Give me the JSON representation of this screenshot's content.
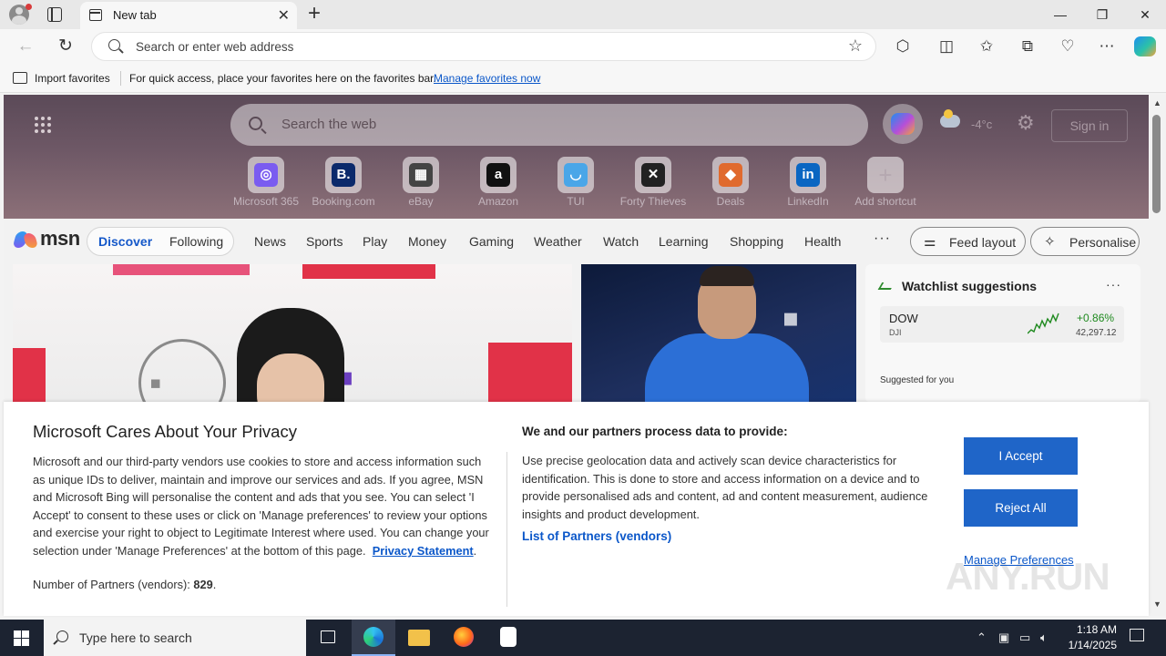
{
  "browser": {
    "tab": {
      "title": "New tab",
      "close": "✕"
    },
    "new_tab": "+",
    "window": {
      "minimize": "—",
      "restore": "❐",
      "close": "✕"
    },
    "address": {
      "placeholder": "Search or enter web address"
    },
    "favorites_bar": {
      "import_label": "Import favorites",
      "message": "For quick access, place your favorites here on the favorites bar.",
      "manage_link": "Manage favorites now"
    }
  },
  "newtab": {
    "search_placeholder": "Search the web",
    "weather_temp": "-4°c",
    "sign_in": "Sign in",
    "shortcuts": [
      {
        "label": "Microsoft 365",
        "glyph": "◎",
        "color": "#7a5cf0"
      },
      {
        "label": "Booking.com",
        "glyph": "B.",
        "color": "#0b2a6b"
      },
      {
        "label": "eBay",
        "glyph": "▦",
        "color": "#444444"
      },
      {
        "label": "Amazon",
        "glyph": "a",
        "color": "#111111"
      },
      {
        "label": "TUI",
        "glyph": "◡",
        "color": "#4aa6e8"
      },
      {
        "label": "Forty Thieves",
        "glyph": "✕",
        "color": "#222222"
      },
      {
        "label": "Deals",
        "glyph": "◆",
        "color": "#e06a2e"
      },
      {
        "label": "LinkedIn",
        "glyph": "in",
        "color": "#0a66c2"
      },
      {
        "label": "Add shortcut",
        "glyph": "+",
        "color": "#b5a8b0"
      }
    ]
  },
  "msn": {
    "logo": "msn",
    "pills": {
      "discover": "Discover",
      "following": "Following"
    },
    "nav": [
      "News",
      "Sports",
      "Play",
      "Money",
      "Gaming",
      "Weather",
      "Watch",
      "Learning",
      "Shopping",
      "Health"
    ],
    "more": "···",
    "feed_layout": "Feed layout",
    "personalise": "Personalise"
  },
  "watchlist": {
    "title": "Watchlist suggestions",
    "more": "···",
    "row": {
      "symbol": "DOW",
      "exchange": "DJI",
      "change": "+0.86%",
      "price": "42,297.12"
    },
    "suggested": "Suggested for you"
  },
  "consent": {
    "title": "Microsoft Cares About Your Privacy",
    "body": "Microsoft and our third-party vendors use cookies to store and access information such as unique IDs to deliver, maintain and improve our services and ads. If you agree, MSN and Microsoft Bing will personalise the content and ads that you see. You can select 'I Accept' to consent to these uses or click on 'Manage preferences' to review your options and exercise your right to object to Legitimate Interest where used.  You can change your selection under 'Manage Preferences' at the bottom of this page.",
    "privacy_link": "Privacy Statement",
    "partners_label": "Number of Partners (vendors):",
    "partners_count": "829",
    "subtitle": "We and our partners process data to provide:",
    "sub_body": "Use precise geolocation data and actively scan device characteristics for identification. This is done to store and access information on a device and to provide personalised ads and content, ad and content measurement, audience insights and product development.",
    "vendors_link": "List of Partners (vendors)",
    "accept": "I Accept",
    "reject": "Reject All",
    "manage": "Manage Preferences"
  },
  "watermark": "ANY.RUN",
  "taskbar": {
    "search_placeholder": "Type here to search",
    "time": "1:18 AM",
    "date": "1/14/2025"
  },
  "colors": {
    "accent": "#1f65c8",
    "link": "#0b57c9",
    "positive": "#1f8a1f"
  }
}
